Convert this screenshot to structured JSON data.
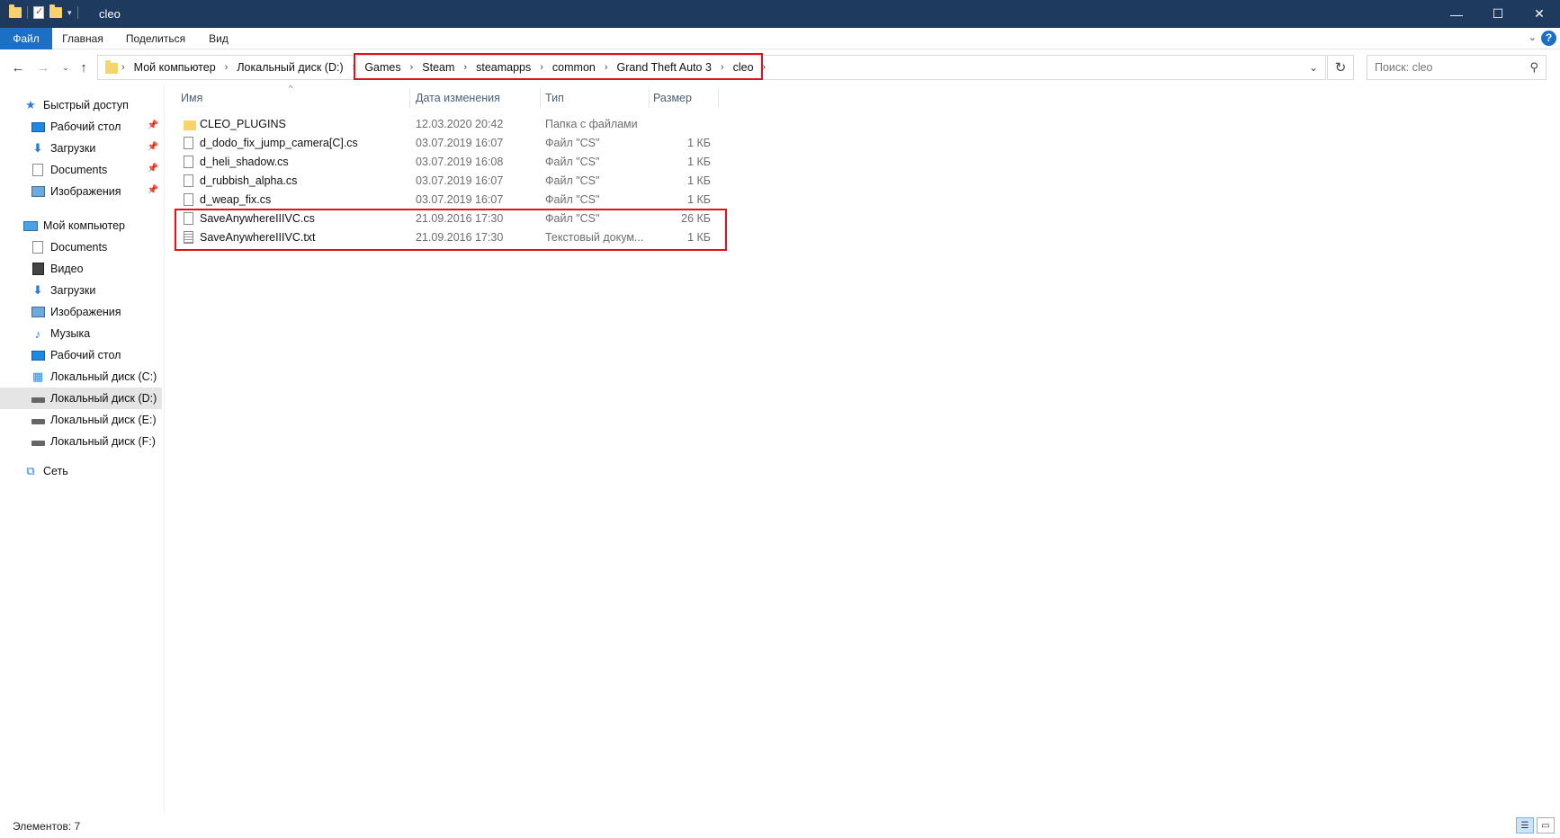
{
  "window": {
    "title": "cleo",
    "minimize": "—",
    "maximize": "☐",
    "close": "✕"
  },
  "ribbon": {
    "tabs": [
      "Файл",
      "Главная",
      "Поделиться",
      "Вид"
    ],
    "collapse_icon": "chevron-down-icon",
    "help": "?"
  },
  "nav": {
    "breadcrumbs": [
      "Мой компьютер",
      "Локальный диск (D:)",
      "Games",
      "Steam",
      "steamapps",
      "common",
      "Grand Theft Auto 3",
      "cleo"
    ],
    "search_placeholder": "Поиск: cleo"
  },
  "sidebar": {
    "items": [
      {
        "label": "Быстрый доступ",
        "icon": "star-icon"
      },
      {
        "label": "Рабочий стол",
        "icon": "desktop-icon",
        "pinned": true
      },
      {
        "label": "Загрузки",
        "icon": "downloads-icon",
        "pinned": true
      },
      {
        "label": "Documents",
        "icon": "document-icon",
        "pinned": true
      },
      {
        "label": "Изображения",
        "icon": "pictures-icon",
        "pinned": true
      },
      {
        "label": "Мой компьютер",
        "icon": "computer-icon"
      },
      {
        "label": "Documents",
        "icon": "document-icon"
      },
      {
        "label": "Видео",
        "icon": "video-icon"
      },
      {
        "label": "Загрузки",
        "icon": "downloads-icon"
      },
      {
        "label": "Изображения",
        "icon": "pictures-icon"
      },
      {
        "label": "Музыка",
        "icon": "music-icon"
      },
      {
        "label": "Рабочий стол",
        "icon": "desktop-icon"
      },
      {
        "label": "Локальный диск (C:)",
        "icon": "system-drive-icon"
      },
      {
        "label": "Локальный диск (D:)",
        "icon": "drive-icon",
        "selected": true
      },
      {
        "label": "Локальный диск (E:)",
        "icon": "drive-icon"
      },
      {
        "label": "Локальный диск (F:)",
        "icon": "drive-icon"
      },
      {
        "label": "Сеть",
        "icon": "network-icon"
      }
    ]
  },
  "columns": {
    "name": "Имя",
    "date": "Дата изменения",
    "type": "Тип",
    "size": "Размер"
  },
  "files": [
    {
      "name": "CLEO_PLUGINS",
      "date": "12.03.2020 20:42",
      "type": "Папка с файлами",
      "size": "",
      "icon": "folder-icon"
    },
    {
      "name": "d_dodo_fix_jump_camera[C].cs",
      "date": "03.07.2019 16:07",
      "type": "Файл \"CS\"",
      "size": "1 КБ",
      "icon": "file-icon"
    },
    {
      "name": "d_heli_shadow.cs",
      "date": "03.07.2019 16:08",
      "type": "Файл \"CS\"",
      "size": "1 КБ",
      "icon": "file-icon"
    },
    {
      "name": "d_rubbish_alpha.cs",
      "date": "03.07.2019 16:07",
      "type": "Файл \"CS\"",
      "size": "1 КБ",
      "icon": "file-icon"
    },
    {
      "name": "d_weap_fix.cs",
      "date": "03.07.2019 16:07",
      "type": "Файл \"CS\"",
      "size": "1 КБ",
      "icon": "file-icon"
    },
    {
      "name": "SaveAnywhereIIIVC.cs",
      "date": "21.09.2016 17:30",
      "type": "Файл \"CS\"",
      "size": "26 КБ",
      "icon": "file-icon"
    },
    {
      "name": "SaveAnywhereIIIVC.txt",
      "date": "21.09.2016 17:30",
      "type": "Текстовый докум...",
      "size": "1 КБ",
      "icon": "text-file-icon"
    }
  ],
  "status": {
    "count": "Элементов: 7"
  },
  "colors": {
    "titlebar": "#1f3a5f",
    "file_tab": "#1c6fc4",
    "highlight": "#e3101a"
  }
}
